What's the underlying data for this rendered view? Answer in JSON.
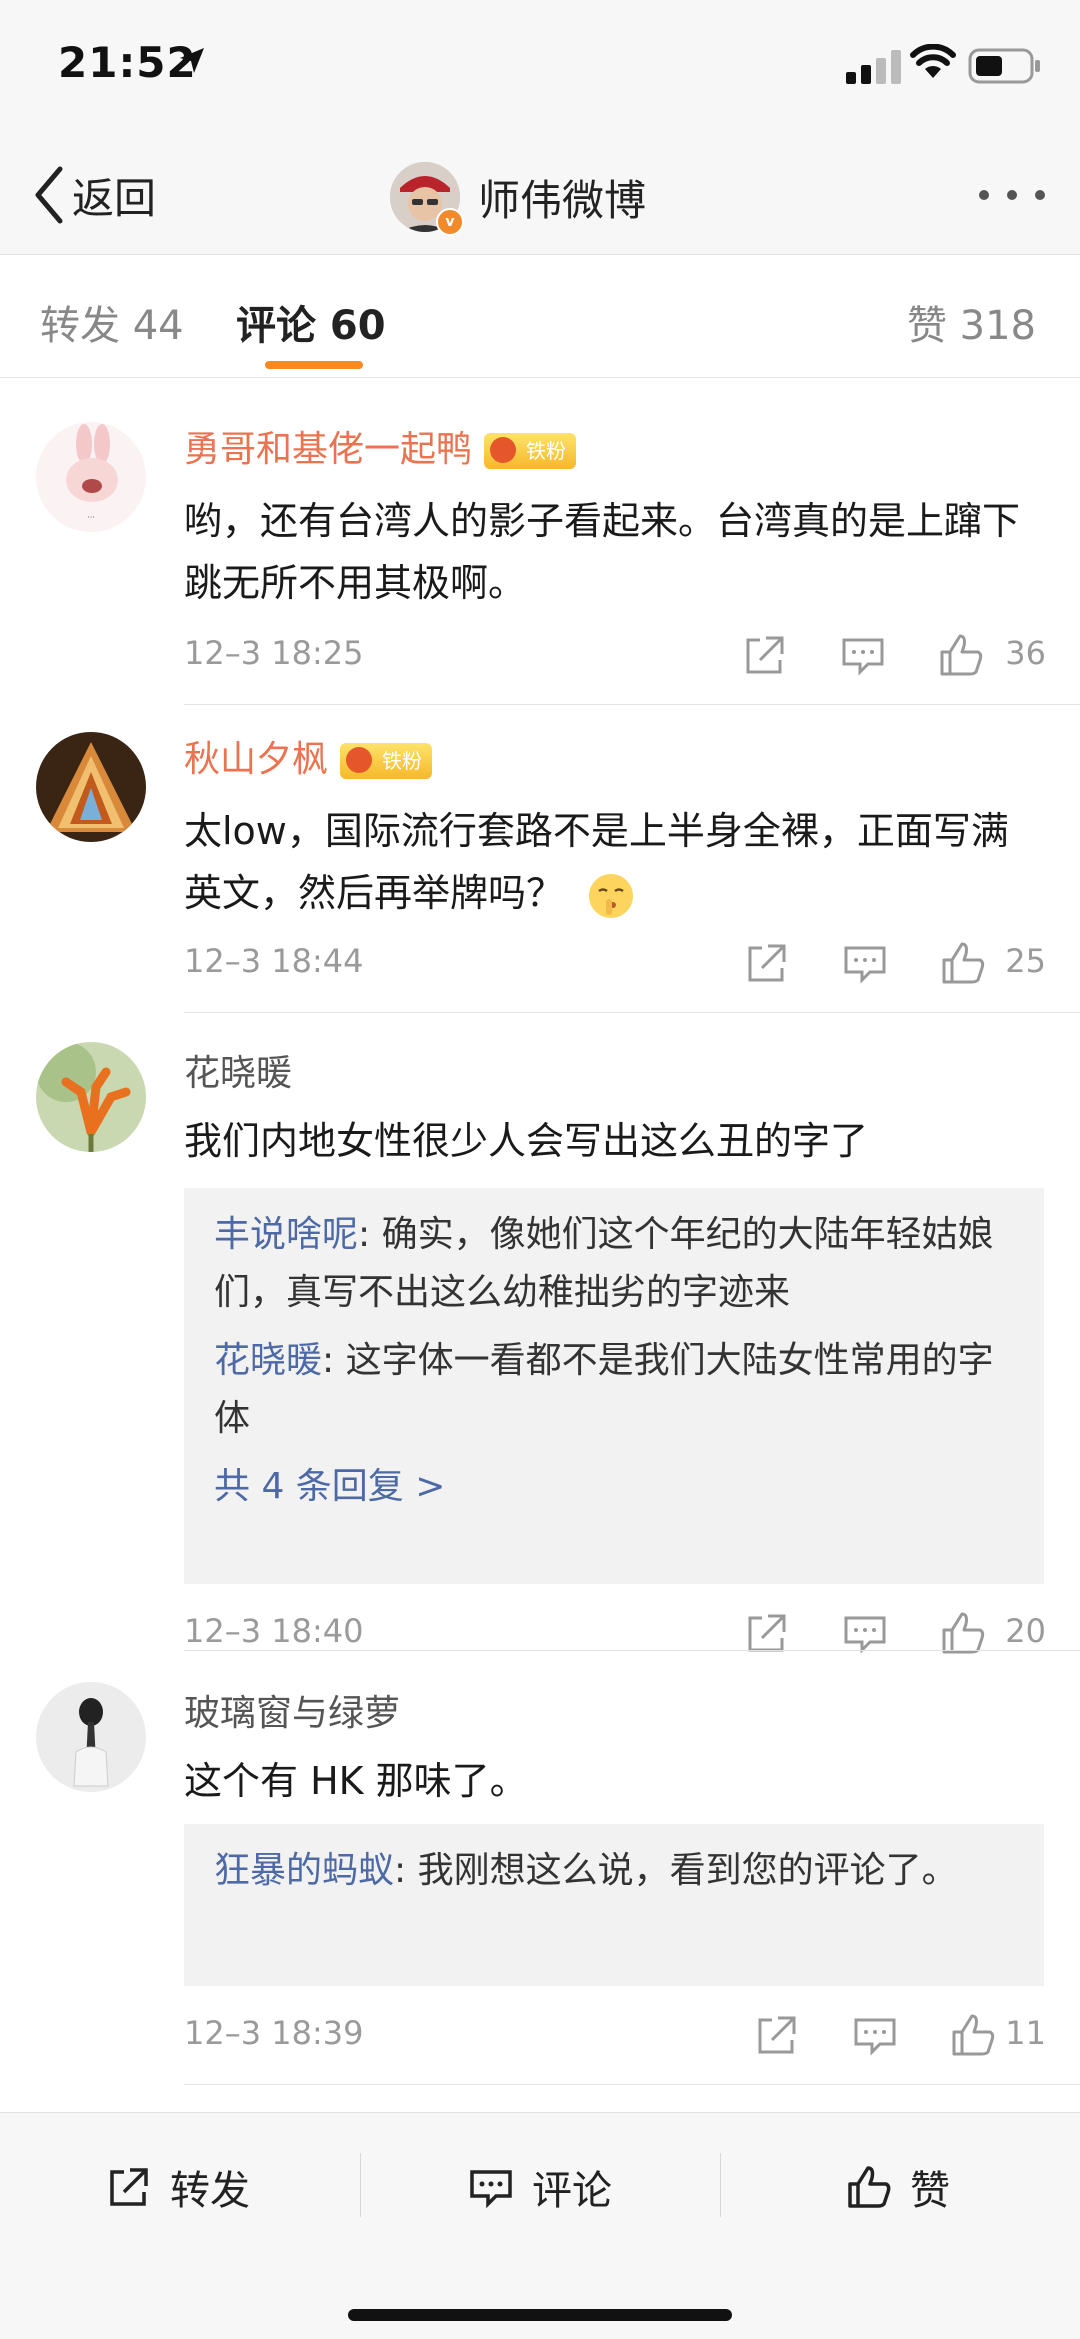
{
  "status_bar": {
    "time": "21:52"
  },
  "nav": {
    "back_label": "返回",
    "title": "师伟微博"
  },
  "tabs": {
    "repost": "转发 44",
    "comment": "评论 60",
    "like": "赞 318"
  },
  "comments": [
    {
      "name": "勇哥和基佬一起鸭",
      "badge": "铁粉",
      "text": "哟，还有台湾人的影子看起来。台湾真的是上蹿下跳无所不用其极啊。",
      "time": "12–3 18:25",
      "likes": "36"
    },
    {
      "name": "秋山夕枫",
      "badge": "铁粉",
      "text": "太low，国际流行套路不是上半身全裸，正面写满英文，然后再举牌吗？",
      "time": "12–3 18:44",
      "likes": "25"
    },
    {
      "name": "花晓暖",
      "text": "我们内地女性很少人会写出这么丑的字了",
      "replies": [
        {
          "name": "丰说啥呢",
          "text": ": 确实，像她们这个年纪的大陆年轻姑娘们，真写不出这么幼稚拙劣的字迹来"
        },
        {
          "name": "花晓暖",
          "text": ": 这字体一看都不是我们大陆女性常用的字体"
        }
      ],
      "more_replies": "共 4 条回复 >",
      "time": "12–3 18:40",
      "likes": "20"
    },
    {
      "name": "玻璃窗与绿萝",
      "text": "这个有 HK 那味了。",
      "replies": [
        {
          "name": "狂暴的蚂蚁",
          "text": ": 我刚想这么说，看到您的评论了。"
        }
      ],
      "time": "12–3 18:39",
      "likes": "11"
    }
  ],
  "bottom_bar": {
    "repost": "转发",
    "comment": "评论",
    "like": "赞"
  },
  "colors": {
    "accent": "#f88a22",
    "name_orange": "#eb7350",
    "reply_name": "#4e6aa6",
    "meta_gray": "#9a9a9a"
  }
}
